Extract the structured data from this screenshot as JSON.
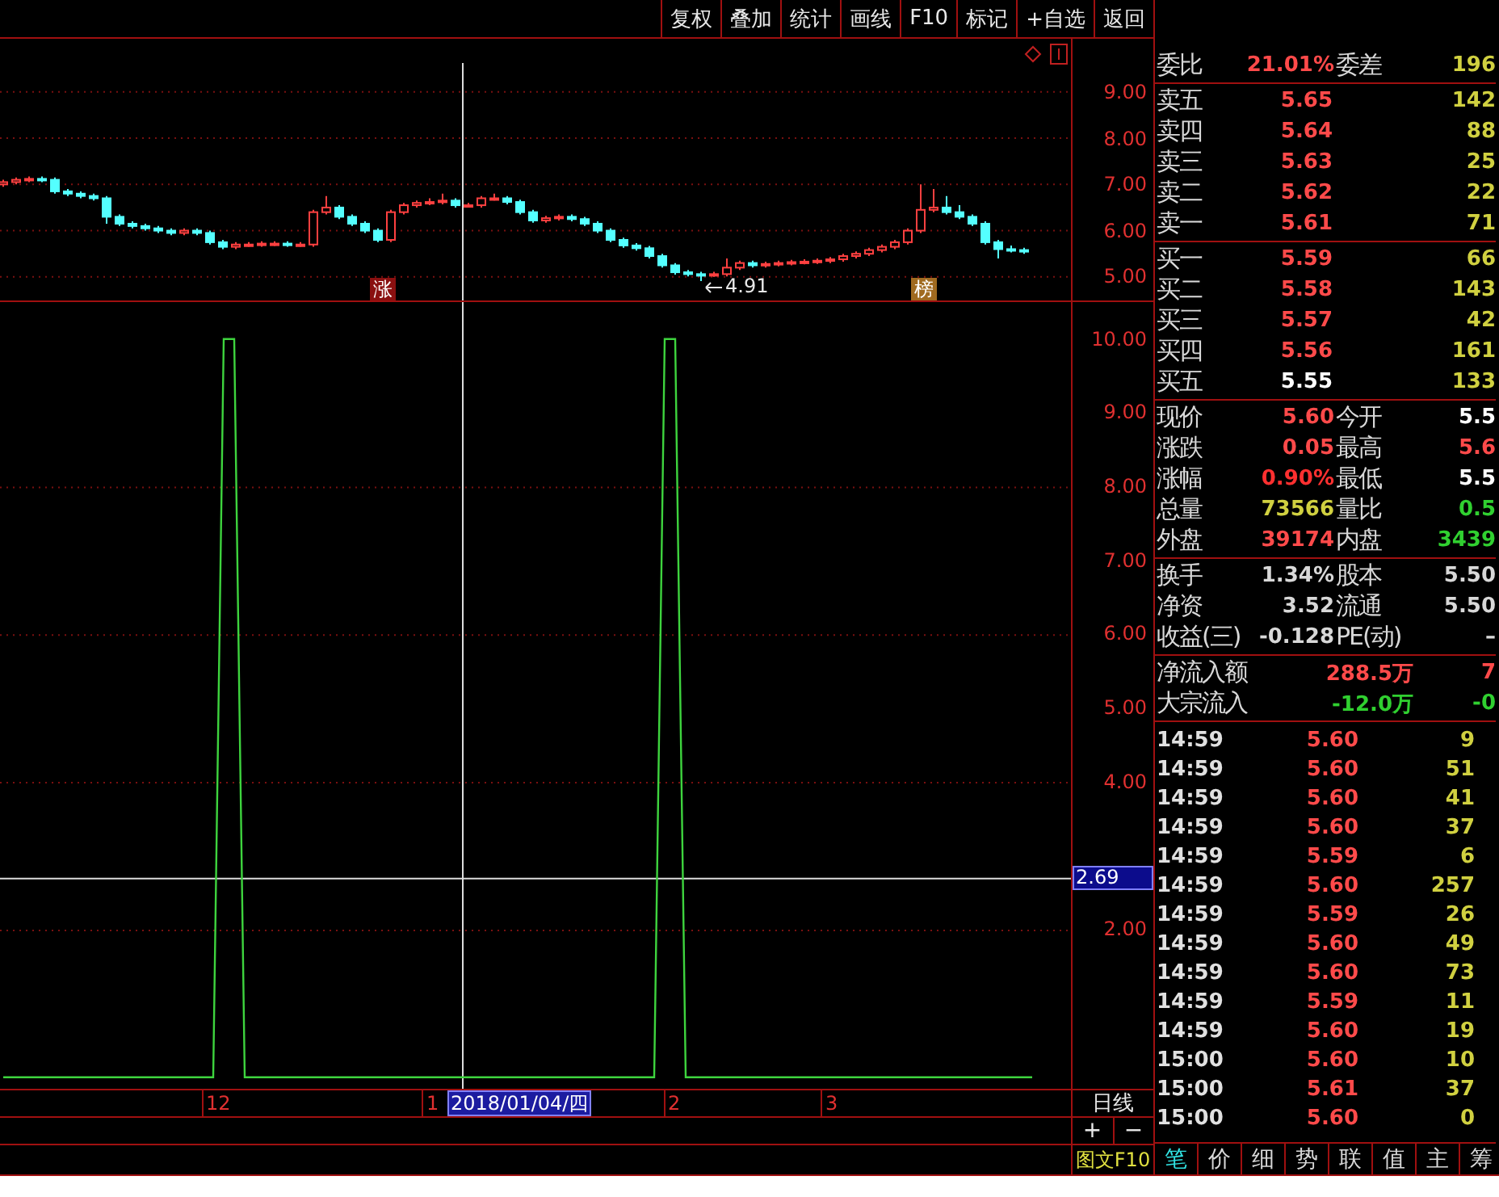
{
  "toolbar": {
    "buttons": [
      "复权",
      "叠加",
      "统计",
      "画线",
      "F10",
      "标记",
      "+自选",
      "返回"
    ]
  },
  "price_chart": {
    "markers": [
      {
        "kind": "rise",
        "label": "涨"
      },
      {
        "kind": "list",
        "label": "榜"
      }
    ],
    "low_label": "4.91",
    "chart_data": {
      "type": "candlestick",
      "ylim": [
        4.49,
        10.15
      ],
      "grid": true,
      "yticks": [
        {
          "value": 9,
          "label": "9.00"
        },
        {
          "value": 8,
          "label": "8.00"
        },
        {
          "value": 7,
          "label": "7.00"
        },
        {
          "value": 6,
          "label": "6.00"
        },
        {
          "value": 5,
          "label": "5.00"
        }
      ],
      "ohlc": [
        [
          7.0,
          7.1,
          6.95,
          7.05
        ],
        [
          7.05,
          7.15,
          7.0,
          7.1
        ],
        [
          7.1,
          7.17,
          7.05,
          7.12
        ],
        [
          7.12,
          7.17,
          7.05,
          7.1
        ],
        [
          7.1,
          7.15,
          6.8,
          6.85
        ],
        [
          6.85,
          6.9,
          6.75,
          6.8
        ],
        [
          6.8,
          6.85,
          6.7,
          6.75
        ],
        [
          6.75,
          6.8,
          6.65,
          6.7
        ],
        [
          6.7,
          6.75,
          6.15,
          6.3
        ],
        [
          6.3,
          6.35,
          6.1,
          6.15
        ],
        [
          6.15,
          6.2,
          6.05,
          6.1
        ],
        [
          6.1,
          6.15,
          6.0,
          6.05
        ],
        [
          6.05,
          6.1,
          5.95,
          6.0
        ],
        [
          6.0,
          6.05,
          5.9,
          5.95
        ],
        [
          5.95,
          6.05,
          5.9,
          6.0
        ],
        [
          6.0,
          6.05,
          5.9,
          5.95
        ],
        [
          5.95,
          6.0,
          5.7,
          5.75
        ],
        [
          5.75,
          5.8,
          5.6,
          5.65
        ],
        [
          5.65,
          5.75,
          5.6,
          5.7
        ],
        [
          5.7,
          5.75,
          5.65,
          5.7
        ],
        [
          5.7,
          5.77,
          5.65,
          5.72
        ],
        [
          5.72,
          5.77,
          5.67,
          5.72
        ],
        [
          5.72,
          5.77,
          5.65,
          5.7
        ],
        [
          5.7,
          5.75,
          5.65,
          5.7
        ],
        [
          5.7,
          6.45,
          5.65,
          6.4
        ],
        [
          6.4,
          6.75,
          6.35,
          6.5
        ],
        [
          6.5,
          6.55,
          6.25,
          6.3
        ],
        [
          6.3,
          6.35,
          6.1,
          6.15
        ],
        [
          6.15,
          6.2,
          5.95,
          6.0
        ],
        [
          6.0,
          6.05,
          5.75,
          5.8
        ],
        [
          5.8,
          6.45,
          5.75,
          6.4
        ],
        [
          6.4,
          6.6,
          6.35,
          6.55
        ],
        [
          6.55,
          6.65,
          6.5,
          6.6
        ],
        [
          6.6,
          6.7,
          6.55,
          6.62
        ],
        [
          6.62,
          6.8,
          6.57,
          6.65
        ],
        [
          6.65,
          6.7,
          6.5,
          6.55
        ],
        [
          6.55,
          6.6,
          6.5,
          6.55
        ],
        [
          6.55,
          6.75,
          6.5,
          6.7
        ],
        [
          6.7,
          6.8,
          6.65,
          6.7
        ],
        [
          6.7,
          6.75,
          6.57,
          6.62
        ],
        [
          6.62,
          6.67,
          6.35,
          6.4
        ],
        [
          6.4,
          6.45,
          6.17,
          6.22
        ],
        [
          6.22,
          6.32,
          6.17,
          6.27
        ],
        [
          6.27,
          6.35,
          6.22,
          6.3
        ],
        [
          6.3,
          6.35,
          6.2,
          6.25
        ],
        [
          6.25,
          6.3,
          6.1,
          6.15
        ],
        [
          6.15,
          6.2,
          5.95,
          6.0
        ],
        [
          6.0,
          6.05,
          5.75,
          5.8
        ],
        [
          5.8,
          5.85,
          5.63,
          5.68
        ],
        [
          5.68,
          5.73,
          5.57,
          5.62
        ],
        [
          5.62,
          5.67,
          5.4,
          5.45
        ],
        [
          5.45,
          5.5,
          5.2,
          5.25
        ],
        [
          5.25,
          5.3,
          5.05,
          5.1
        ],
        [
          5.1,
          5.15,
          5.01,
          5.06
        ],
        [
          5.06,
          5.11,
          4.91,
          5.05
        ],
        [
          5.05,
          5.11,
          5.0,
          5.06
        ],
        [
          5.06,
          5.4,
          5.01,
          5.2
        ],
        [
          5.2,
          5.35,
          5.15,
          5.3
        ],
        [
          5.3,
          5.35,
          5.2,
          5.25
        ],
        [
          5.25,
          5.33,
          5.2,
          5.28
        ],
        [
          5.28,
          5.35,
          5.23,
          5.3
        ],
        [
          5.3,
          5.37,
          5.25,
          5.32
        ],
        [
          5.32,
          5.38,
          5.27,
          5.33
        ],
        [
          5.33,
          5.4,
          5.28,
          5.35
        ],
        [
          5.35,
          5.43,
          5.3,
          5.38
        ],
        [
          5.38,
          5.5,
          5.33,
          5.45
        ],
        [
          5.45,
          5.55,
          5.4,
          5.5
        ],
        [
          5.5,
          5.63,
          5.45,
          5.58
        ],
        [
          5.58,
          5.7,
          5.53,
          5.65
        ],
        [
          5.65,
          5.8,
          5.6,
          5.75
        ],
        [
          5.75,
          6.05,
          5.7,
          6.0
        ],
        [
          6.0,
          7.0,
          5.95,
          6.45
        ],
        [
          6.45,
          6.9,
          6.4,
          6.5
        ],
        [
          6.5,
          6.75,
          6.35,
          6.4
        ],
        [
          6.4,
          6.55,
          6.25,
          6.3
        ],
        [
          6.3,
          6.35,
          6.1,
          6.15
        ],
        [
          6.15,
          6.2,
          5.7,
          5.75
        ],
        [
          5.75,
          5.8,
          5.4,
          5.6
        ],
        [
          5.6,
          5.68,
          5.53,
          5.58
        ],
        [
          5.58,
          5.63,
          5.5,
          5.55
        ]
      ]
    }
  },
  "indicator_chart": {
    "cursor_value": "2.69",
    "chart_data": {
      "type": "line",
      "ylim": [
        -0.2,
        10.5
      ],
      "grid": true,
      "ref_lines": [
        {
          "axis": "y",
          "value": 2.69,
          "color": "#dcdcdc"
        }
      ],
      "yticks": [
        {
          "value": 2,
          "label": "2.00"
        },
        {
          "value": 4,
          "label": "4.00"
        },
        {
          "value": 5,
          "label": "5.00"
        },
        {
          "value": 6,
          "label": "6.00"
        },
        {
          "value": 7,
          "label": "7.00"
        },
        {
          "value": 8,
          "label": "8.00"
        },
        {
          "value": 9,
          "label": "9.00"
        },
        {
          "value": 10,
          "label": "10.00"
        }
      ],
      "series": [
        {
          "color": "#3ed43e",
          "values": [
            0,
            0,
            0,
            0,
            0,
            0,
            0,
            0,
            0,
            0,
            0,
            0,
            0,
            0,
            0,
            0,
            0,
            0,
            0,
            0,
            0,
            10,
            10,
            0,
            0,
            0,
            0,
            0,
            0,
            0,
            0,
            0,
            0,
            0,
            0,
            0,
            0,
            0,
            0,
            0,
            0,
            0,
            0,
            0,
            0,
            0,
            0,
            0,
            0,
            0,
            0,
            0,
            0,
            0,
            0,
            0,
            0,
            0,
            0,
            0,
            0,
            0,
            0,
            10,
            10,
            0,
            0,
            0,
            0,
            0,
            0,
            0,
            0,
            0,
            0,
            0,
            0,
            0,
            0,
            0,
            0,
            0,
            0,
            0,
            0,
            0,
            0,
            0,
            0,
            0,
            0,
            0,
            0,
            0,
            0,
            0,
            0,
            0,
            0
          ]
        }
      ]
    }
  },
  "date_axis": {
    "labels": [
      "12",
      "1",
      "2",
      "3"
    ],
    "cursor_date": "2018/01/04/四",
    "period": "日线"
  },
  "zoom_buttons": [
    "+",
    "−"
  ],
  "f10_button": "图文F10",
  "quote": {
    "ratio_row": {
      "label": "委比",
      "value": "21.01%",
      "label2": "委差",
      "value2": "196"
    },
    "asks": [
      {
        "label": "卖五",
        "price": "5.65",
        "color": "#ff4a4a",
        "volume": "142"
      },
      {
        "label": "卖四",
        "price": "5.64",
        "color": "#ff4a4a",
        "volume": "88"
      },
      {
        "label": "卖三",
        "price": "5.63",
        "color": "#ff4a4a",
        "volume": "25"
      },
      {
        "label": "卖二",
        "price": "5.62",
        "color": "#ff4a4a",
        "volume": "22"
      },
      {
        "label": "卖一",
        "price": "5.61",
        "color": "#ff4a4a",
        "volume": "71"
      }
    ],
    "bids": [
      {
        "label": "买一",
        "price": "5.59",
        "color": "#ff4a4a",
        "volume": "66"
      },
      {
        "label": "买二",
        "price": "5.58",
        "color": "#ff4a4a",
        "volume": "143"
      },
      {
        "label": "买三",
        "price": "5.57",
        "color": "#ff4a4a",
        "volume": "42"
      },
      {
        "label": "买四",
        "price": "5.56",
        "color": "#ff4a4a",
        "volume": "161"
      },
      {
        "label": "买五",
        "price": "5.55",
        "color": "#ffffff",
        "volume": "133"
      }
    ],
    "stats": [
      {
        "left": {
          "label": "现价",
          "value": "5.60",
          "color": "#ff4a4a"
        },
        "right": {
          "label": "今开",
          "value": "5.5",
          "color": "#ffffff"
        }
      },
      {
        "left": {
          "label": "涨跌",
          "value": "0.05",
          "color": "#ff4a4a"
        },
        "right": {
          "label": "最高",
          "value": "5.6",
          "color": "#ff4a4a"
        }
      },
      {
        "left": {
          "label": "涨幅",
          "value": "0.90%",
          "color": "#ff3030"
        },
        "right": {
          "label": "最低",
          "value": "5.5",
          "color": "#ffffff"
        }
      },
      {
        "left": {
          "label": "总量",
          "value": "73566",
          "color": "#d0d040"
        },
        "right": {
          "label": "量比",
          "value": "0.5",
          "color": "#30d030"
        }
      },
      {
        "left": {
          "label": "外盘",
          "value": "39174",
          "color": "#ff4a4a"
        },
        "right": {
          "label": "内盘",
          "value": "3439",
          "color": "#30d030"
        }
      }
    ],
    "fundamentals": [
      {
        "label": "换手",
        "value": "1.34%",
        "label2": "股本",
        "value2": "5.50"
      },
      {
        "label": "净资",
        "value": "3.52",
        "label2": "流通",
        "value2": "5.50"
      },
      {
        "label": "收益(三)",
        "value": "-0.128",
        "label2": "PE(动)",
        "value2": "–"
      }
    ],
    "flows": [
      {
        "label": "净流入额",
        "amount": {
          "value": "288.5万",
          "color": "#ff4a4a"
        },
        "share": {
          "value": "7",
          "color": "#ff4a4a"
        }
      },
      {
        "label": "大宗流入",
        "amount": {
          "value": "-12.0万",
          "color": "#30d030"
        },
        "share": {
          "value": "-0",
          "color": "#30d030"
        }
      }
    ],
    "ticks": [
      {
        "time": "14:59",
        "price": "5.60",
        "volume": "9"
      },
      {
        "time": "14:59",
        "price": "5.60",
        "volume": "51"
      },
      {
        "time": "14:59",
        "price": "5.60",
        "volume": "41"
      },
      {
        "time": "14:59",
        "price": "5.60",
        "volume": "37"
      },
      {
        "time": "14:59",
        "price": "5.59",
        "volume": "6"
      },
      {
        "time": "14:59",
        "price": "5.60",
        "volume": "257"
      },
      {
        "time": "14:59",
        "price": "5.59",
        "volume": "26"
      },
      {
        "time": "14:59",
        "price": "5.60",
        "volume": "49"
      },
      {
        "time": "14:59",
        "price": "5.60",
        "volume": "73"
      },
      {
        "time": "14:59",
        "price": "5.59",
        "volume": "11"
      },
      {
        "time": "14:59",
        "price": "5.60",
        "volume": "19"
      },
      {
        "time": "15:00",
        "price": "5.60",
        "volume": "10"
      },
      {
        "time": "15:00",
        "price": "5.61",
        "volume": "37"
      },
      {
        "time": "15:00",
        "price": "5.60",
        "volume": "0"
      }
    ]
  },
  "tabs": [
    {
      "label": "笔",
      "selected": true
    },
    {
      "label": "价",
      "selected": false
    },
    {
      "label": "细",
      "selected": false
    },
    {
      "label": "势",
      "selected": false
    },
    {
      "label": "联",
      "selected": false
    },
    {
      "label": "值",
      "selected": false
    },
    {
      "label": "主",
      "selected": false
    },
    {
      "label": "筹",
      "selected": false
    }
  ]
}
